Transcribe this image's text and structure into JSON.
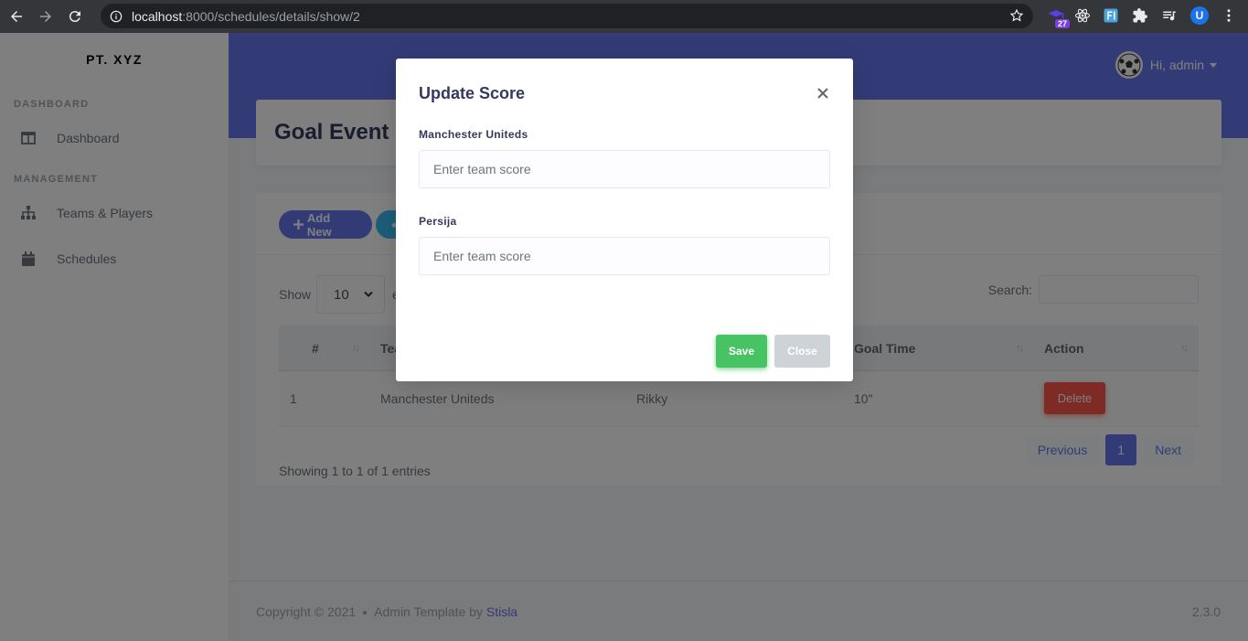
{
  "browser": {
    "url_host": "localhost",
    "url_rest": ":8000/schedules/details/show/2",
    "ext_badge": "27",
    "profile_initial": "U"
  },
  "sidebar": {
    "brand": "PT. XYZ",
    "sections": [
      {
        "header": "DASHBOARD",
        "items": [
          {
            "label": "Dashboard",
            "icon": "columns-icon"
          }
        ]
      },
      {
        "header": "MANAGEMENT",
        "items": [
          {
            "label": "Teams & Players",
            "icon": "sitemap-icon"
          },
          {
            "label": "Schedules",
            "icon": "calendar-icon"
          }
        ]
      }
    ]
  },
  "topbar": {
    "user_greeting": "Hi, admin"
  },
  "page": {
    "title": "Goal Event"
  },
  "card": {
    "add_button": "Add New",
    "show_label": "Show",
    "entries_value": "10",
    "entries_suffix": "en",
    "search_label": "Search:",
    "table": {
      "headers": [
        "#",
        "Tea",
        "Goal Time",
        "Action"
      ],
      "rows": [
        {
          "num": "1",
          "team": "Manchester Uniteds",
          "player": "Rikky",
          "goal_time": "10\"",
          "action": "Delete"
        }
      ]
    },
    "info": "Showing 1 to 1 of 1 entries",
    "pagination": {
      "previous": "Previous",
      "current": "1",
      "next": "Next"
    }
  },
  "footer": {
    "copyright": "Copyright © 2021",
    "template_text": "Admin Template by",
    "template_link": "Stisla",
    "version": "2.3.0"
  },
  "modal": {
    "title": "Update Score",
    "fields": [
      {
        "label": "Manchester Uniteds",
        "placeholder": "Enter team score",
        "value": ""
      },
      {
        "label": "Persija",
        "placeholder": "Enter team score",
        "value": ""
      }
    ],
    "save_label": "Save",
    "close_label": "Close"
  },
  "colors": {
    "primary": "#6777ef",
    "success": "#47c363",
    "danger": "#fc544b",
    "secondary": "#cdd3d8"
  }
}
